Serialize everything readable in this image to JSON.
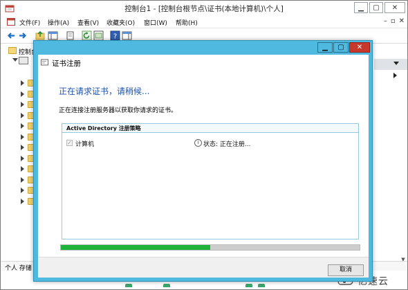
{
  "mmc": {
    "title": "控制台1 - [控制台根节点\\证书(本地计算机)\\个人]",
    "menu": [
      "文件(F)",
      "操作(A)",
      "查看(V)",
      "收藏夹(O)",
      "窗口(W)",
      "帮助(H)"
    ],
    "tree_root_label": "控制台",
    "status_text": "个人 存储"
  },
  "dialog": {
    "title": "证书注册",
    "heading": "正在请求证书，请稍候...",
    "subtext": "正在连接注册服务器以获取你请求的证书。",
    "policy_header": "Active Directory 注册策略",
    "policy_item_label": "计算机",
    "status_label": "状态: 正在注册...",
    "progress_fraction": 0.5,
    "cancel_label": "取消"
  },
  "watermark": {
    "text": "亿速云"
  },
  "colors": {
    "dialog_frame": "#4fb9e0",
    "heading": "#1e55a9",
    "progress": "#20b33c",
    "close_red": "#c7392b"
  }
}
